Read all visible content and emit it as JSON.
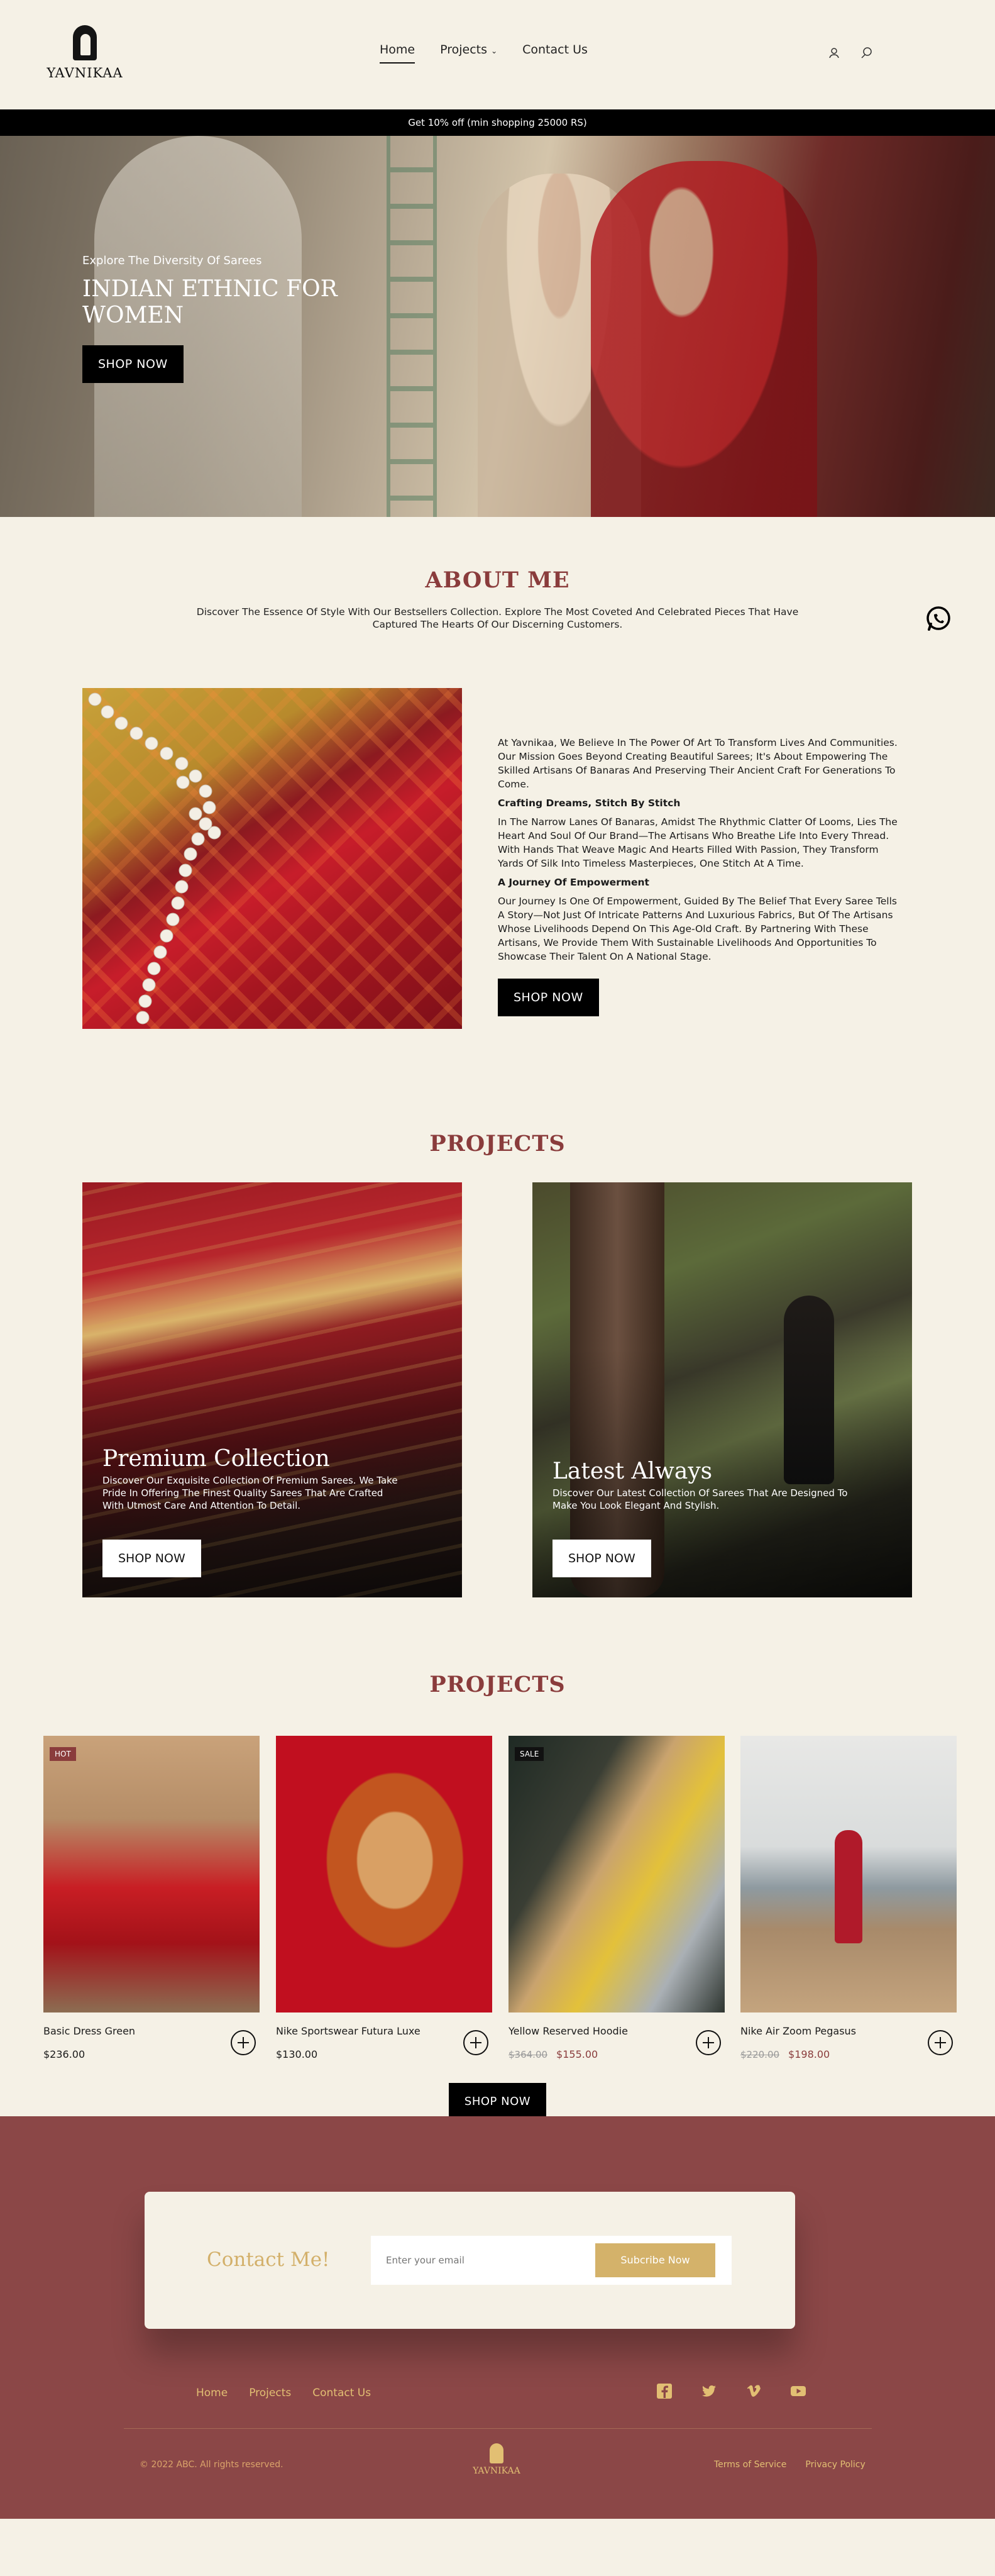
{
  "brand": {
    "name": "YAVNIKAA"
  },
  "nav": {
    "home": "Home",
    "projects": "Projects",
    "contact": "Contact Us"
  },
  "promo": "Get 10% off (min shopping 25000 RS)",
  "hero": {
    "eyebrow": "Explore The Diversity Of Sarees",
    "title": "INDIAN ETHNIC FOR WOMEN",
    "cta": "SHOP NOW"
  },
  "about": {
    "title": "ABOUT ME",
    "subtitle": "Discover The Essence Of Style With Our Bestsellers Collection. Explore The Most Coveted And Celebrated Pieces That Have Captured The Hearts Of Our Discerning Customers.",
    "intro": "At Yavnikaa, We Believe In The Power Of Art To Transform Lives And Communities. Our Mission Goes Beyond Creating Beautiful Sarees; It's About Empowering The Skilled Artisans Of Banaras And Preserving Their Ancient Craft For Generations To Come.",
    "h1": "Crafting Dreams, Stitch By Stitch",
    "p1": "In The Narrow Lanes Of Banaras, Amidst The Rhythmic Clatter Of Looms, Lies The Heart And Soul Of Our Brand—The Artisans Who Breathe Life Into Every Thread. With Hands That Weave Magic And Hearts Filled With Passion, They Transform Yards Of Silk Into Timeless Masterpieces, One Stitch At A Time.",
    "h2": "A Journey Of Empowerment",
    "p2": "Our Journey Is One Of Empowerment, Guided By The Belief That Every Saree Tells A Story—Not Just Of Intricate Patterns And Luxurious Fabrics, But Of The Artisans Whose Livelihoods Depend On This Age-Old Craft. By Partnering With These Artisans, We Provide Them With Sustainable Livelihoods And Opportunities To Showcase Their Talent On A National Stage.",
    "cta": "SHOP NOW"
  },
  "projects": {
    "title": "PROJECTS",
    "cards": [
      {
        "title": "Premium Collection",
        "desc": "Discover Our Exquisite Collection Of Premium Sarees. We Take Pride In Offering The Finest Quality Sarees That Are Crafted With Utmost Care And Attention To Detail.",
        "cta": "SHOP NOW"
      },
      {
        "title": "Latest Always",
        "desc": "Discover Our Latest Collection Of Sarees That Are Designed To Make You Look Elegant And Stylish.",
        "cta": "SHOP NOW"
      }
    ]
  },
  "products": {
    "title": "PROJECTS",
    "items": [
      {
        "badge": "HOT",
        "name": "Basic Dress Green",
        "price": "$236.00",
        "old_price": ""
      },
      {
        "badge": "",
        "name": "Nike Sportswear Futura Luxe",
        "price": "$130.00",
        "old_price": ""
      },
      {
        "badge": "SALE",
        "name": "Yellow Reserved Hoodie",
        "price": "$155.00",
        "old_price": "$364.00"
      },
      {
        "badge": "",
        "name": "Nike Air Zoom Pegasus",
        "price": "$198.00",
        "old_price": "$220.00"
      }
    ],
    "cta": "SHOP NOW"
  },
  "footer": {
    "contact_title": "Contact Me!",
    "email_placeholder": "Enter your email",
    "subscribe": "Subcribe Now",
    "links": [
      "Home",
      "Projects",
      "Contact Us"
    ],
    "social": [
      "facebook-icon",
      "twitter-icon",
      "vimeo-icon",
      "youtube-icon"
    ],
    "copyright": "© 2022 ABC. All rights reserved.",
    "brand": "YAVNIKAA",
    "terms": "Terms of Service",
    "privacy": "Privacy Policy"
  },
  "colors": {
    "accent": "#8a3c3c",
    "gold": "#d4b26a",
    "bg": "#f5f1e6",
    "footer_bg": "#8b4747"
  }
}
